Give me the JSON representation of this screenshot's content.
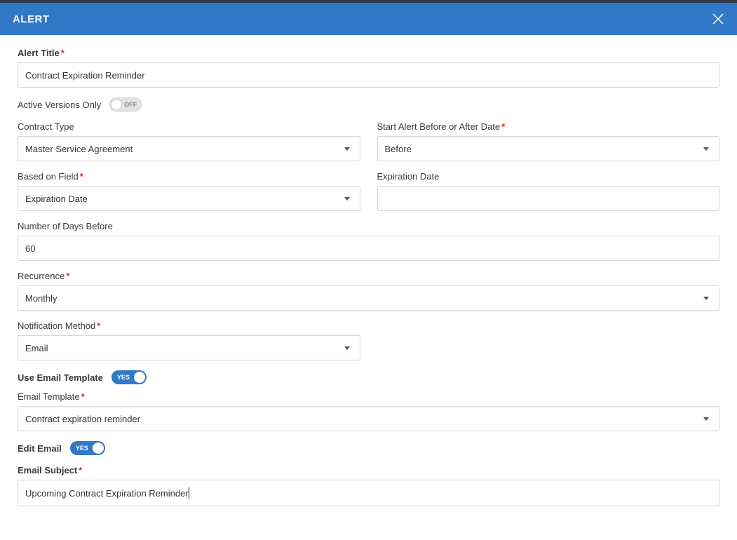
{
  "header": {
    "title": "ALERT"
  },
  "labels": {
    "alert_title": "Alert Title",
    "active_versions_only": "Active Versions Only",
    "contract_type": "Contract Type",
    "start_alert": "Start Alert Before or After Date",
    "based_on_field": "Based on Field",
    "expiration_date": "Expiration Date",
    "number_of_days_before": "Number of Days Before",
    "recurrence": "Recurrence",
    "notification_method": "Notification Method",
    "use_email_template": "Use Email Template",
    "email_template": "Email Template",
    "edit_email": "Edit Email",
    "email_subject": "Email Subject"
  },
  "values": {
    "alert_title": "Contract Expiration Reminder",
    "contract_type": "Master Service Agreement",
    "start_alert": "Before",
    "based_on_field": "Expiration Date",
    "number_of_days_before": "60",
    "recurrence": "Monthly",
    "notification_method": "Email",
    "email_template": "Contract expiration reminder",
    "email_subject": "Upcoming Contract Expiration Reminder"
  },
  "toggles": {
    "off": "OFF",
    "yes": "YES"
  },
  "asterisk": "*"
}
